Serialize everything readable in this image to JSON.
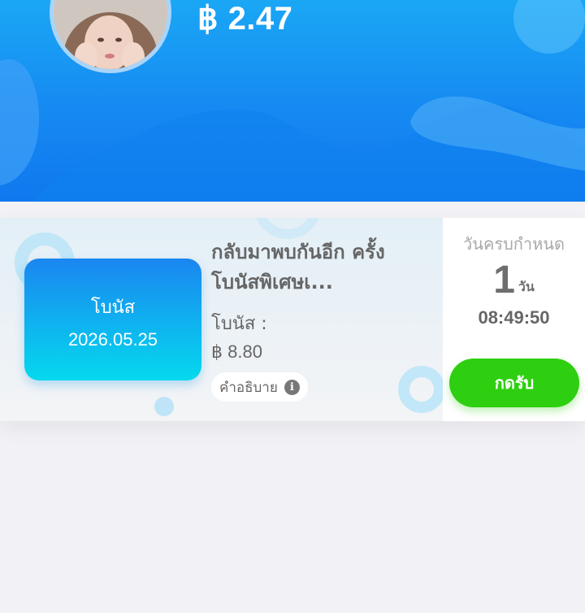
{
  "header": {
    "balance": "฿ 2.47",
    "avatar_alt": "user-avatar"
  },
  "bonus_card": {
    "ticket": {
      "label": "โบนัส",
      "date": "2026.05.25"
    },
    "title": "กลับมาพบกันอีก ครั้ง โบนัสพิเศษเ...",
    "bonus_label": "โบนัส :",
    "bonus_amount": "฿ 8.80",
    "description_button": "คำอธิบาย",
    "due_label": "วันครบกำหนด",
    "days_count": "1",
    "days_unit": "วัน",
    "countdown": "08:49:50",
    "claim_button": "กดรับ"
  },
  "colors": {
    "header_blue": "#1689f2",
    "claim_green": "#2ecf10",
    "ticket_start": "#1a86f0",
    "ticket_end": "#05d9ee"
  }
}
